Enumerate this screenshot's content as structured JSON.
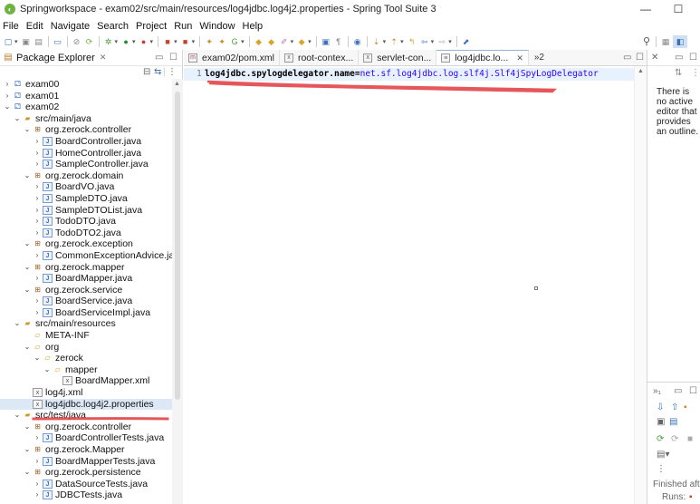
{
  "window": {
    "title": "Springworkspace - exam02/src/main/resources/log4jdbc.log4j2.properties - Spring Tool Suite 3",
    "minimize": "—",
    "maximize": "☐"
  },
  "menu": [
    "File",
    "Edit",
    "Navigate",
    "Search",
    "Project",
    "Run",
    "Window",
    "Help"
  ],
  "package_explorer": {
    "title": "Package Explorer",
    "close": "✕",
    "tree": [
      {
        "label": "exam00",
        "depth": 0,
        "twisty": "›",
        "icon": "project"
      },
      {
        "label": "exam01",
        "depth": 0,
        "twisty": "›",
        "icon": "project"
      },
      {
        "label": "exam02",
        "depth": 0,
        "twisty": "⌄",
        "icon": "project"
      },
      {
        "label": "src/main/java",
        "depth": 1,
        "twisty": "⌄",
        "icon": "srcfolder"
      },
      {
        "label": "org.zerock.controller",
        "depth": 2,
        "twisty": "⌄",
        "icon": "package"
      },
      {
        "label": "BoardController.java",
        "depth": 3,
        "twisty": "›",
        "icon": "java"
      },
      {
        "label": "HomeController.java",
        "depth": 3,
        "twisty": "›",
        "icon": "java"
      },
      {
        "label": "SampleController.java",
        "depth": 3,
        "twisty": "›",
        "icon": "java"
      },
      {
        "label": "org.zerock.domain",
        "depth": 2,
        "twisty": "⌄",
        "icon": "package"
      },
      {
        "label": "BoardVO.java",
        "depth": 3,
        "twisty": "›",
        "icon": "java"
      },
      {
        "label": "SampleDTO.java",
        "depth": 3,
        "twisty": "›",
        "icon": "java"
      },
      {
        "label": "SampleDTOList.java",
        "depth": 3,
        "twisty": "›",
        "icon": "java"
      },
      {
        "label": "TodoDTO.java",
        "depth": 3,
        "twisty": "›",
        "icon": "java"
      },
      {
        "label": "TodoDTO2.java",
        "depth": 3,
        "twisty": "›",
        "icon": "java"
      },
      {
        "label": "org.zerock.exception",
        "depth": 2,
        "twisty": "⌄",
        "icon": "package"
      },
      {
        "label": "CommonExceptionAdvice.java",
        "depth": 3,
        "twisty": "›",
        "icon": "java"
      },
      {
        "label": "org.zerock.mapper",
        "depth": 2,
        "twisty": "⌄",
        "icon": "package"
      },
      {
        "label": "BoardMapper.java",
        "depth": 3,
        "twisty": "›",
        "icon": "java"
      },
      {
        "label": "org.zerock.service",
        "depth": 2,
        "twisty": "⌄",
        "icon": "package"
      },
      {
        "label": "BoardService.java",
        "depth": 3,
        "twisty": "›",
        "icon": "java"
      },
      {
        "label": "BoardServiceImpl.java",
        "depth": 3,
        "twisty": "›",
        "icon": "java"
      },
      {
        "label": "src/main/resources",
        "depth": 1,
        "twisty": "⌄",
        "icon": "srcfolder"
      },
      {
        "label": "META-INF",
        "depth": 2,
        "twisty": "",
        "icon": "folder"
      },
      {
        "label": "org",
        "depth": 2,
        "twisty": "⌄",
        "icon": "folder"
      },
      {
        "label": "zerock",
        "depth": 3,
        "twisty": "⌄",
        "icon": "folder"
      },
      {
        "label": "mapper",
        "depth": 4,
        "twisty": "⌄",
        "icon": "folder"
      },
      {
        "label": "BoardMapper.xml",
        "depth": 5,
        "twisty": "",
        "icon": "file"
      },
      {
        "label": "log4j.xml",
        "depth": 2,
        "twisty": "",
        "icon": "file"
      },
      {
        "label": "log4jdbc.log4j2.properties",
        "depth": 2,
        "twisty": "",
        "icon": "file",
        "selected": true
      },
      {
        "label": "src/test/java",
        "depth": 1,
        "twisty": "⌄",
        "icon": "srcfolder"
      },
      {
        "label": "org.zerock.controller",
        "depth": 2,
        "twisty": "⌄",
        "icon": "package"
      },
      {
        "label": "BoardControllerTests.java",
        "depth": 3,
        "twisty": "›",
        "icon": "java"
      },
      {
        "label": "org.zerock.Mapper",
        "depth": 2,
        "twisty": "⌄",
        "icon": "package"
      },
      {
        "label": "BoardMapperTests.java",
        "depth": 3,
        "twisty": "›",
        "icon": "java"
      },
      {
        "label": "org.zerock.persistence",
        "depth": 2,
        "twisty": "⌄",
        "icon": "package"
      },
      {
        "label": "DataSourceTests.java",
        "depth": 3,
        "twisty": "›",
        "icon": "java"
      },
      {
        "label": "JDBCTests.java",
        "depth": 3,
        "twisty": "›",
        "icon": "java"
      }
    ]
  },
  "editor": {
    "tabs": [
      {
        "label": "exam02/pom.xml",
        "active": false
      },
      {
        "label": "root-contex...",
        "active": false
      },
      {
        "label": "servlet-con...",
        "active": false
      },
      {
        "label": "log4jdbc.lo...",
        "active": true
      }
    ],
    "tab_close": "✕",
    "overflow": "»2",
    "line_number": "1",
    "code_key": "log4jdbc.spylogdelegator.name=",
    "code_value": "net.sf.log4jdbc.log.slf4j.Slf4jSpyLogDelegator"
  },
  "outline": {
    "message": "There is no active editor that provides an outline.",
    "finished": "Finished after",
    "runs": "Runs:"
  },
  "colors": {
    "annotation": "#e0393e",
    "selection": "#dde8f7",
    "code_value": "#2a00ff"
  }
}
